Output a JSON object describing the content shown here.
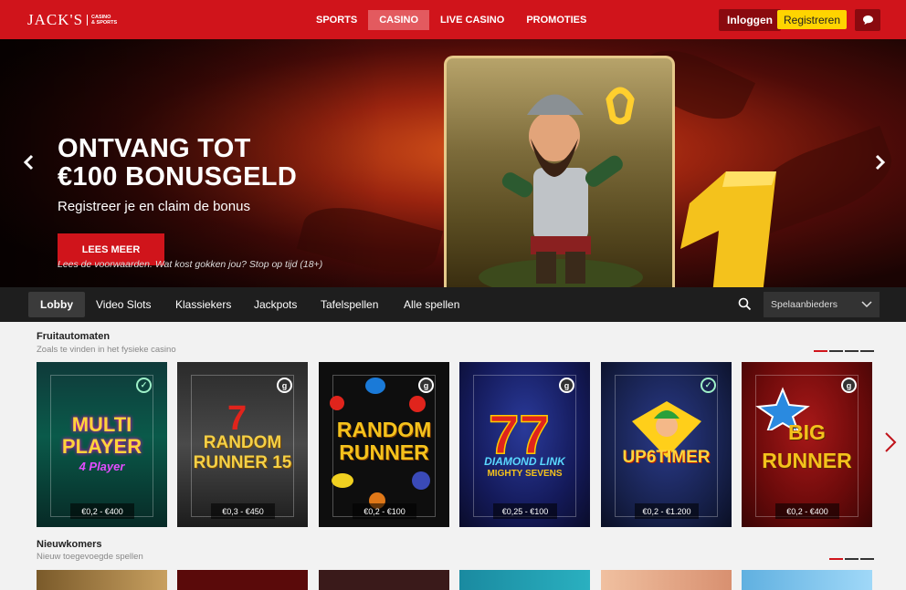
{
  "header": {
    "logo_main": "JACK'S",
    "logo_sub1": "CASINO",
    "logo_sub2": "& SPORTS",
    "nav": [
      "SPORTS",
      "CASINO",
      "LIVE CASINO",
      "PROMOTIES"
    ],
    "nav_active": "CASINO",
    "login_label": "Inloggen",
    "register_label": "Registreren",
    "chat_icon": "chat-bubble-icon",
    "accent": "#d0141b",
    "register_color": "#ffd400"
  },
  "hero": {
    "title_line1": "ONTVANG TOT",
    "title_line2": "€100 BONUSGELD",
    "subtitle": "Registreer je en claim de bonus",
    "cta": "LEES MEER",
    "disclaimer": "Lees de voorwaarden. Wat kost gokken jou? Stop op tijd (18+)",
    "prev_icon": "chevron-left-icon",
    "next_icon": "chevron-right-icon"
  },
  "categories": {
    "items": [
      "Lobby",
      "Video Slots",
      "Klassiekers",
      "Jackpots",
      "Tafelspellen",
      "Alle spellen"
    ],
    "active": "Lobby",
    "search_icon": "search-icon",
    "provider_placeholder": "Spelaanbieders"
  },
  "fruit": {
    "title": "Fruitautomaten",
    "subtitle": "Zoals te vinden in het fysieke casino",
    "games": [
      {
        "name_line1": "MULTI",
        "name_line2": "PLAYER",
        "name_line3": "4 Player",
        "price": "€0,2 - €400",
        "badge": "✓"
      },
      {
        "name_line1": "RANDOM",
        "name_line2": "RUNNER 15",
        "name_line3": "",
        "price": "€0,3 - €450",
        "badge": "g"
      },
      {
        "name_line1": "RANDOM",
        "name_line2": "RUNNER",
        "name_line3": "",
        "price": "€0,2 - €100",
        "badge": "g"
      },
      {
        "name_line1": "DIAMOND LINK",
        "name_line2": "MIGHTY SEVENS",
        "name_line3": "",
        "price": "€0,25 - €100",
        "badge": "g"
      },
      {
        "name_line1": "UP6TIMER",
        "name_line2": "",
        "name_line3": "",
        "price": "€0,2 - €1.200",
        "badge": "✓"
      },
      {
        "name_line1": "BIG",
        "name_line2": "RUNNER",
        "name_line3": "",
        "price": "€0,2 - €400",
        "badge": "g"
      }
    ]
  },
  "new": {
    "title": "Nieuwkomers",
    "subtitle": "Nieuw toegevoegde spellen"
  }
}
